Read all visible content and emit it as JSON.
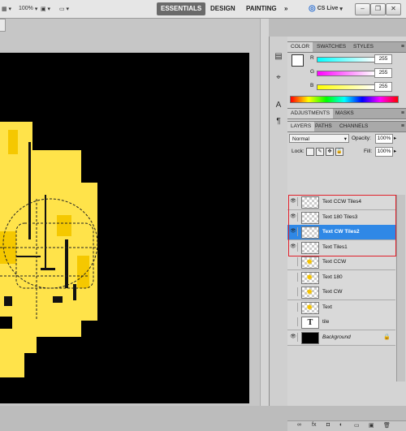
{
  "toolbar": {
    "zoom_value": "100%",
    "workspaces": {
      "essentials": "ESSENTIALS",
      "design": "DESIGN",
      "painting": "PAINTING",
      "more": "»"
    },
    "cslive": "CS Live"
  },
  "color_panel": {
    "tabs": [
      "COLOR",
      "SWATCHES",
      "STYLES"
    ],
    "r_label": "R",
    "g_label": "G",
    "b_label": "B",
    "r_value": "255",
    "g_value": "255",
    "b_value": "255"
  },
  "adjust_panel": {
    "tabs": [
      "ADJUSTMENTS",
      "MASKS"
    ]
  },
  "layers_panel": {
    "tabs": [
      "LAYERS",
      "PATHS",
      "CHANNELS"
    ],
    "blend_mode": "Normal",
    "opacity_label": "Opacity:",
    "opacity_value": "100%",
    "lock_label": "Lock:",
    "fill_label": "Fill:",
    "fill_value": "100%",
    "layers": [
      {
        "name": "Text CCW Tiles4",
        "visible": true,
        "selected": false,
        "thumb": "checker"
      },
      {
        "name": "Text 180 Tiles3",
        "visible": true,
        "selected": false,
        "thumb": "checker"
      },
      {
        "name": "Text CW Tiles2",
        "visible": true,
        "selected": true,
        "thumb": "checker"
      },
      {
        "name": "Text Tiles1",
        "visible": true,
        "selected": false,
        "thumb": "checker"
      },
      {
        "name": "Text CCW",
        "visible": false,
        "selected": false,
        "thumb": "star"
      },
      {
        "name": "Text 180",
        "visible": false,
        "selected": false,
        "thumb": "star"
      },
      {
        "name": "Text CW",
        "visible": false,
        "selected": false,
        "thumb": "star"
      },
      {
        "name": "Text",
        "visible": false,
        "selected": false,
        "thumb": "star"
      },
      {
        "name": "tile",
        "visible": false,
        "selected": false,
        "thumb": "type"
      },
      {
        "name": "Background",
        "visible": true,
        "selected": false,
        "thumb": "black"
      }
    ]
  },
  "colors": {
    "accent_select": "#2f88e6",
    "highlight_box": "#e0202a",
    "artwork_yellow": "#ffe34a"
  }
}
